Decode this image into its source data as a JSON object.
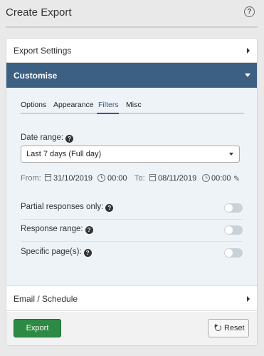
{
  "header": {
    "title": "Create Export",
    "help_icon": "question-circle-icon",
    "help_glyph": "?"
  },
  "sections": {
    "export_settings": "Export Settings",
    "customise": "Customise",
    "email_schedule": "Email / Schedule"
  },
  "tabs": [
    {
      "label": "Options",
      "active": false
    },
    {
      "label": "Appearance",
      "active": false
    },
    {
      "label": "Filters",
      "active": true
    },
    {
      "label": "Misc",
      "active": false
    }
  ],
  "filters": {
    "date_range_label": "Date range:",
    "date_range_value": "Last 7 days (Full day)",
    "from_label": "From:",
    "from_date": "31/10/2019",
    "from_time": "00:00",
    "to_label": "To:",
    "to_date": "08/11/2019",
    "to_time": "00:00",
    "options": [
      {
        "label": "Partial responses only:",
        "enabled": false
      },
      {
        "label": "Response range:",
        "enabled": false
      },
      {
        "label": "Specific page(s):",
        "enabled": false
      }
    ]
  },
  "footer": {
    "export_label": "Export",
    "reset_label": "Reset"
  },
  "colors": {
    "accent": "#3c5f84",
    "export_button": "#2d8a44",
    "panel_bg": "#eef3f8"
  }
}
